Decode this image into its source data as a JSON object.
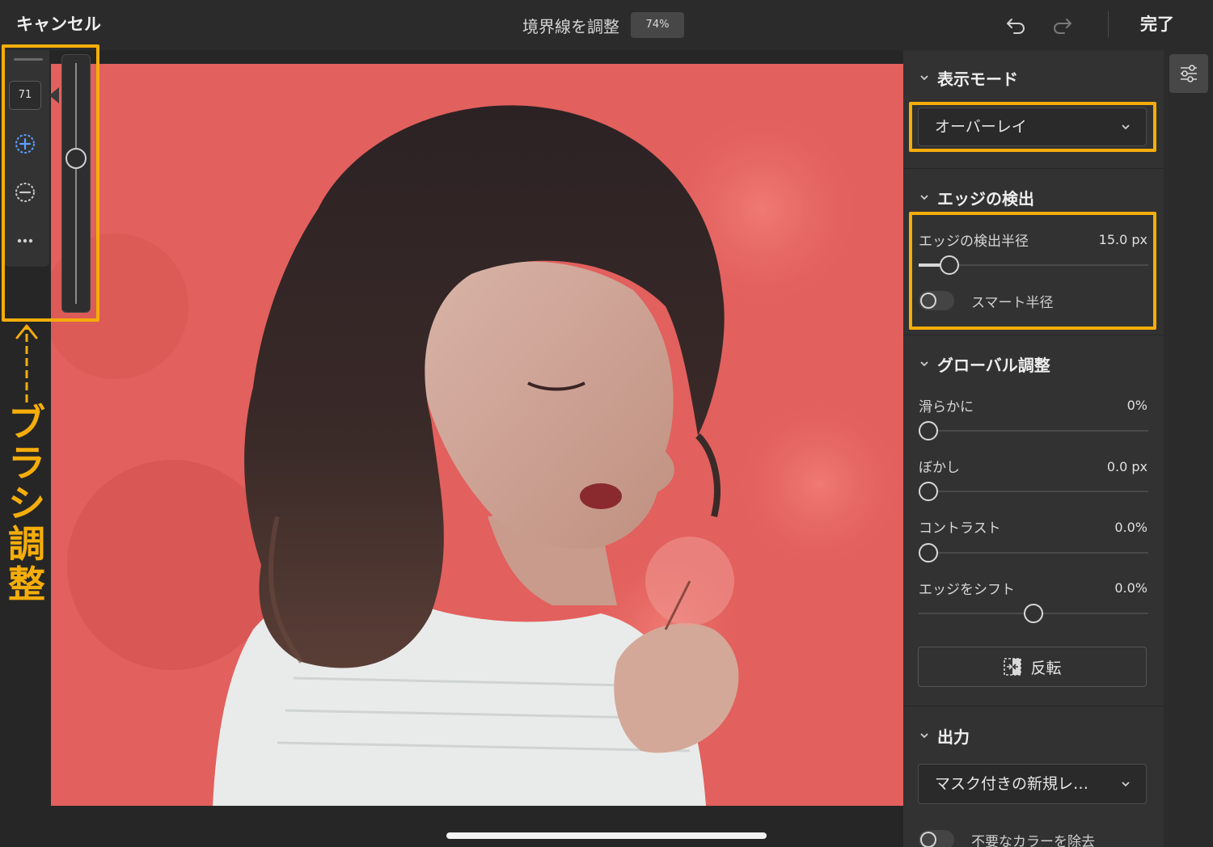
{
  "topbar": {
    "cancel_label": "キャンセル",
    "title": "境界線を調整",
    "zoom": "74%",
    "done_label": "完了"
  },
  "brush": {
    "size": "71",
    "slider_level": 0.6
  },
  "annotation": {
    "label": "ブラシ調整",
    "color": "#f5ad0a"
  },
  "panel": {
    "view_mode": {
      "title": "表示モード",
      "selected": "オーバーレイ"
    },
    "edge_detection": {
      "title": "エッジの検出",
      "radius_label": "エッジの検出半径",
      "radius_value": "15.0 px",
      "radius_level": 0.1,
      "smart_radius_label": "スマート半径",
      "smart_radius_on": false
    },
    "global_adjust": {
      "title": "グローバル調整",
      "smooth_label": "滑らかに",
      "smooth_value": "0%",
      "feather_label": "ぼかし",
      "feather_value": "0.0 px",
      "contrast_label": "コントラスト",
      "contrast_value": "0.0%",
      "shift_edge_label": "エッジをシフト",
      "shift_edge_value": "0.0%",
      "shift_edge_level": 0.5,
      "invert_label": "反転"
    },
    "output": {
      "title": "出力",
      "selected": "マスク付きの新規レ…",
      "decontaminate_label": "不要なカラーを除去"
    }
  },
  "colors": {
    "overlay": "#e2605d",
    "panel": "#323232",
    "accent": "#5aa0ff"
  },
  "icons": {
    "undo": "undo-icon",
    "redo": "redo-icon",
    "add_brush": "brush-add-icon",
    "subtract_brush": "brush-subtract-icon",
    "more": "more-icon",
    "settings": "sliders-icon",
    "invert": "invert-icon"
  }
}
